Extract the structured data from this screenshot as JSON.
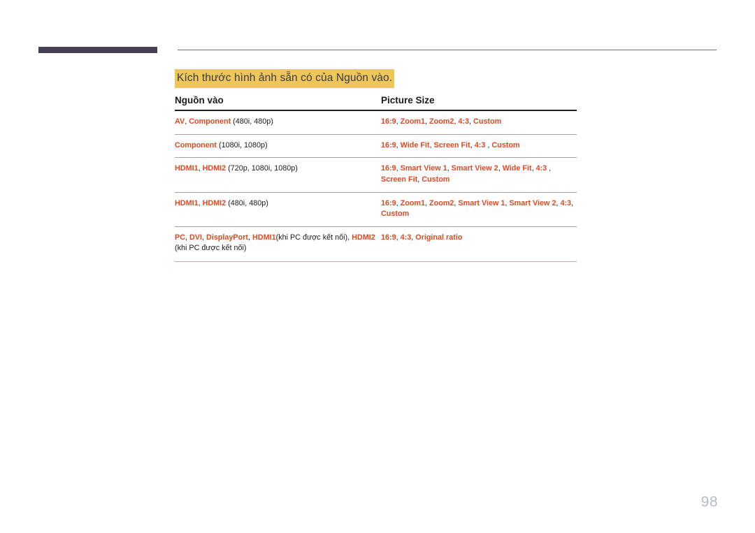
{
  "page": {
    "number": "98",
    "section_title": "Kích thước hình ảnh sẵn có của Nguồn vào.",
    "highlight_color": "#efc758",
    "accent_color": "#dd4a22",
    "corner_bar_color": "#463f54"
  },
  "table": {
    "headers": {
      "col1": "Nguồn vào",
      "col2": "Picture Size"
    },
    "rows": [
      {
        "input_source": [
          {
            "text": "AV",
            "style": "keyword"
          },
          {
            "text": ", ",
            "style": "plain"
          },
          {
            "text": "Component",
            "style": "keyword"
          },
          {
            "text": " (480i, 480p)",
            "style": "plain"
          }
        ],
        "picture_size": [
          {
            "text": "16:9",
            "style": "keyword"
          },
          {
            "text": ", ",
            "style": "plain"
          },
          {
            "text": "Zoom1",
            "style": "keyword"
          },
          {
            "text": ", ",
            "style": "plain"
          },
          {
            "text": "Zoom2",
            "style": "keyword"
          },
          {
            "text": ", ",
            "style": "plain"
          },
          {
            "text": "4:3",
            "style": "keyword"
          },
          {
            "text": ", ",
            "style": "plain"
          },
          {
            "text": "Custom",
            "style": "keyword"
          }
        ],
        "input_source_text": "AV, Component (480i, 480p)",
        "picture_size_text": "16:9, Zoom1, Zoom2, 4:3, Custom"
      },
      {
        "input_source": [
          {
            "text": "Component",
            "style": "keyword"
          },
          {
            "text": " (1080i, 1080p)",
            "style": "plain"
          }
        ],
        "picture_size": [
          {
            "text": "16:9",
            "style": "keyword"
          },
          {
            "text": ", ",
            "style": "plain"
          },
          {
            "text": "Wide Fit",
            "style": "keyword"
          },
          {
            "text": ", ",
            "style": "plain"
          },
          {
            "text": "Screen Fit",
            "style": "keyword"
          },
          {
            "text": ", ",
            "style": "plain"
          },
          {
            "text": "4:3",
            "style": "keyword"
          },
          {
            "text": " , ",
            "style": "plain"
          },
          {
            "text": "Custom",
            "style": "keyword"
          }
        ],
        "input_source_text": "Component (1080i, 1080p)",
        "picture_size_text": "16:9, Wide Fit, Screen Fit, 4:3 , Custom"
      },
      {
        "input_source": [
          {
            "text": "HDMI1",
            "style": "keyword"
          },
          {
            "text": ", ",
            "style": "plain"
          },
          {
            "text": "HDMI2",
            "style": "keyword"
          },
          {
            "text": " (720p, 1080i, 1080p)",
            "style": "plain"
          }
        ],
        "picture_size": [
          {
            "text": "16:9",
            "style": "keyword"
          },
          {
            "text": ", ",
            "style": "plain"
          },
          {
            "text": "Smart View 1",
            "style": "keyword"
          },
          {
            "text": ", ",
            "style": "plain"
          },
          {
            "text": "Smart View 2",
            "style": "keyword"
          },
          {
            "text": ", ",
            "style": "plain"
          },
          {
            "text": "Wide Fit",
            "style": "keyword"
          },
          {
            "text": ", ",
            "style": "plain"
          },
          {
            "text": "4:3",
            "style": "keyword"
          },
          {
            "text": " , ",
            "style": "plain"
          },
          {
            "text": "Screen Fit",
            "style": "keyword"
          },
          {
            "text": ", ",
            "style": "plain"
          },
          {
            "text": "Custom",
            "style": "keyword"
          }
        ],
        "input_source_text": "HDMI1, HDMI2 (720p, 1080i, 1080p)",
        "picture_size_text": "16:9, Smart View 1, Smart View 2, Wide Fit, 4:3 , Screen Fit, Custom"
      },
      {
        "input_source": [
          {
            "text": "HDMI1",
            "style": "keyword"
          },
          {
            "text": ", ",
            "style": "plain"
          },
          {
            "text": "HDMI2",
            "style": "keyword"
          },
          {
            "text": " (480i, 480p)",
            "style": "plain"
          }
        ],
        "picture_size": [
          {
            "text": "16:9",
            "style": "keyword"
          },
          {
            "text": ", ",
            "style": "plain"
          },
          {
            "text": "Zoom1",
            "style": "keyword"
          },
          {
            "text": ", ",
            "style": "plain"
          },
          {
            "text": "Zoom2",
            "style": "keyword"
          },
          {
            "text": ", ",
            "style": "plain"
          },
          {
            "text": "Smart View 1",
            "style": "keyword"
          },
          {
            "text": ", ",
            "style": "plain"
          },
          {
            "text": "Smart View 2",
            "style": "keyword"
          },
          {
            "text": ", ",
            "style": "plain"
          },
          {
            "text": "4:3",
            "style": "keyword"
          },
          {
            "text": ", ",
            "style": "plain"
          },
          {
            "text": "Custom",
            "style": "keyword"
          }
        ],
        "input_source_text": "HDMI1, HDMI2 (480i, 480p)",
        "picture_size_text": "16:9, Zoom1, Zoom2, Smart View 1, Smart View 2, 4:3, Custom"
      },
      {
        "input_source": [
          {
            "text": "PC",
            "style": "keyword"
          },
          {
            "text": ", ",
            "style": "plain"
          },
          {
            "text": "DVI",
            "style": "keyword"
          },
          {
            "text": ", ",
            "style": "plain"
          },
          {
            "text": "DisplayPort",
            "style": "keyword"
          },
          {
            "text": ", ",
            "style": "plain"
          },
          {
            "text": "HDMI1",
            "style": "keyword"
          },
          {
            "text": "(khi PC được kết nối), ",
            "style": "plain"
          },
          {
            "text": "HDMI2",
            "style": "keyword"
          },
          {
            "text": " (khi PC được kết nối)",
            "style": "plain"
          }
        ],
        "picture_size": [
          {
            "text": "16:9",
            "style": "keyword"
          },
          {
            "text": ", ",
            "style": "plain"
          },
          {
            "text": "4:3",
            "style": "keyword"
          },
          {
            "text": ", ",
            "style": "plain"
          },
          {
            "text": "Original ratio",
            "style": "keyword"
          }
        ],
        "input_source_text": "PC, DVI, DisplayPort, HDMI1(khi PC được kết nối), HDMI2 (khi PC được kết nối)",
        "picture_size_text": "16:9, 4:3, Original ratio"
      }
    ]
  }
}
